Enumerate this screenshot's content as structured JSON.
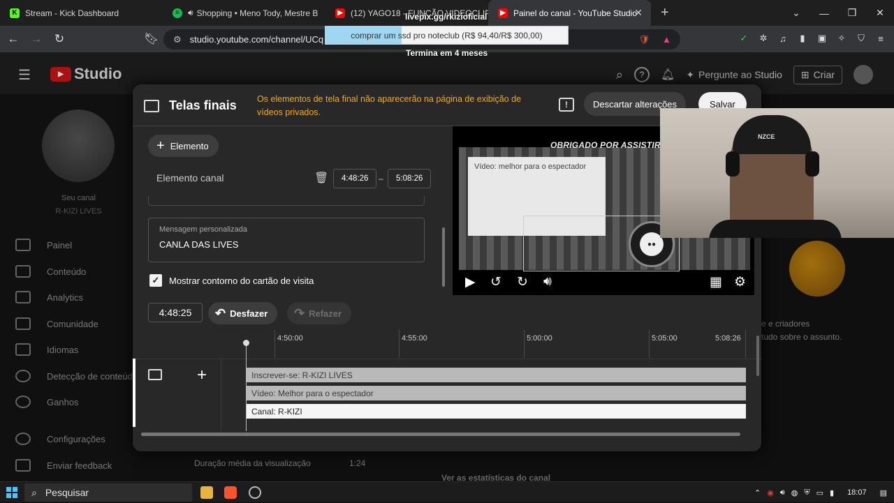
{
  "browser": {
    "tabs": [
      {
        "title": "Stream - Kick Dashboard",
        "favicon": "K",
        "color": "#53fc18",
        "active": false
      },
      {
        "title": "Shopping • Meno Tody, Mestre B",
        "favicon": "♪",
        "color": "#1db954",
        "active": false
      },
      {
        "title": "(12) YAGO18 - FUNÇÃO VIDEOCLIP",
        "favicon": "▶",
        "color": "#ff0000",
        "active": false
      },
      {
        "title": "Painel do canal - YouTube Studio",
        "favicon": "▶",
        "color": "#ff0000",
        "active": true
      }
    ],
    "url": "studio.youtube.com/channel/UCq"
  },
  "overlay": {
    "livepix_url": "livepix.gg/rkizioficial",
    "goal_text": "comprar um ssd pro noteclub (R$ 94,40/R$ 300,00)",
    "goal_progress": 0.315,
    "goal_ends": "Termina em 4 meses"
  },
  "studio_header": {
    "logo_text": "Studio",
    "ask_studio": "Pergunte ao Studio",
    "create": "Criar"
  },
  "sidebar": {
    "channel_label": "Seu canal",
    "channel_name": "R-KIZI LIVES",
    "items": [
      {
        "label": "Painel",
        "icon": "dashboard-icon"
      },
      {
        "label": "Conteúdo",
        "icon": "content-icon"
      },
      {
        "label": "Analytics",
        "icon": "analytics-icon"
      },
      {
        "label": "Comunidade",
        "icon": "community-icon"
      },
      {
        "label": "Idiomas",
        "icon": "subtitles-icon"
      },
      {
        "label": "Detecção de conteúdo",
        "icon": "copyright-icon"
      },
      {
        "label": "Ganhos",
        "icon": "earnings-icon"
      },
      {
        "label": "Configurações",
        "icon": "gear-icon"
      },
      {
        "label": "Enviar feedback",
        "icon": "feedback-icon"
      }
    ]
  },
  "background_text": {
    "avg_duration": "Duração média da visualização",
    "avg_value": "1:24",
    "stats_link": "Ver as estatísticas do canal",
    "creators": "e e criadores",
    "subject": "tudo sobre o assunto."
  },
  "modal": {
    "title": "Telas finais",
    "warning": "Os elementos de tela final não aparecerão na página de exibição de vídeos privados.",
    "discard": "Descartar alterações",
    "save": "Salvar",
    "add_element": "Elemento",
    "element_title": "Elemento canal",
    "start_time": "4:48:26",
    "end_time": "5:08:26",
    "custom_message_label": "Mensagem personalizada",
    "custom_message_value": "CANLA DAS LIVES",
    "show_outline_label": "Mostrar contorno do cartão de visita",
    "show_outline_checked": true,
    "preview": {
      "banner_text": "OBRIGADO POR ASSISTIR",
      "video_card_text": "Vídeo: melhor para o espectador"
    },
    "current_time": "4:48:25",
    "undo": "Desfazer",
    "redo": "Refazer",
    "ruler": [
      "4:50:00",
      "4:55:00",
      "5:00:00",
      "5:05:00",
      "5:08:26"
    ],
    "tracks": [
      {
        "label": "Inscrever-se: R-KIZI LIVES",
        "selected": false
      },
      {
        "label": "Vídeo: Melhor para o espectador",
        "selected": false
      },
      {
        "label": "Canal: R-KIZI",
        "selected": true
      }
    ]
  },
  "webcam": {
    "hat_text": "NZCE"
  },
  "taskbar": {
    "search_placeholder": "Pesquisar",
    "clock": "18:07"
  }
}
